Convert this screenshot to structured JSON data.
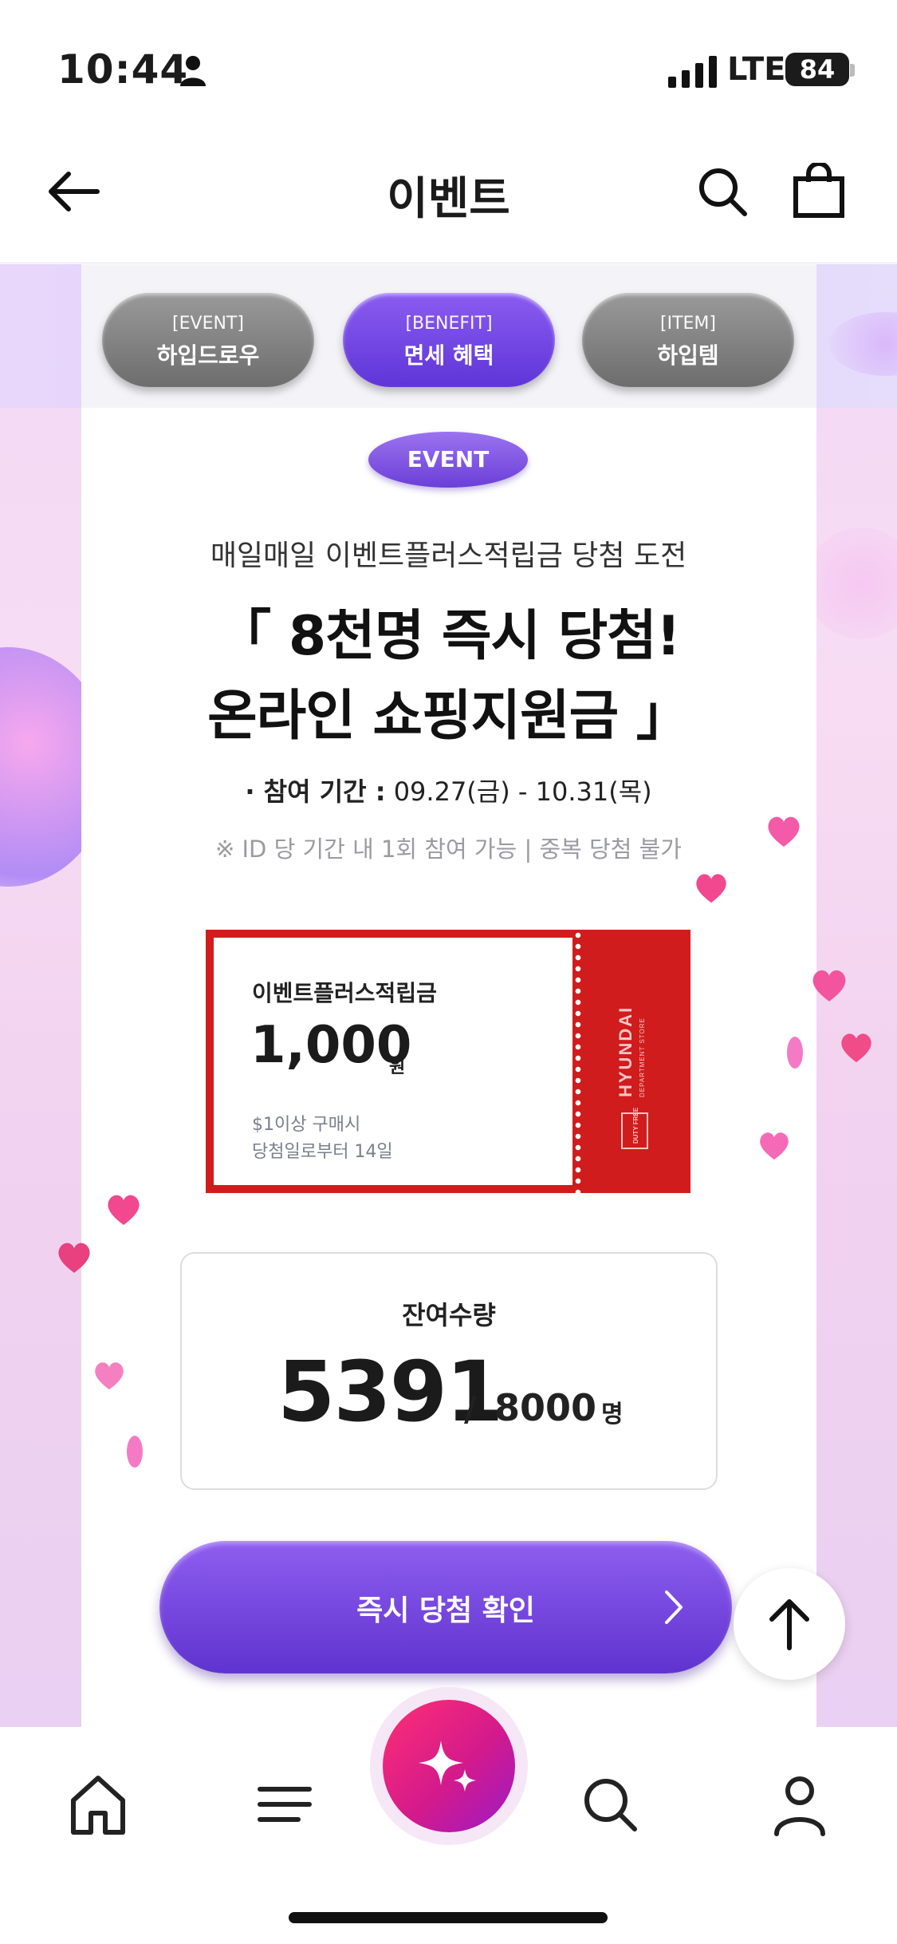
{
  "status_bar": {
    "time": "10:44",
    "network": "LTE",
    "battery": "84"
  },
  "header": {
    "title": "이벤트"
  },
  "tabs": [
    {
      "sub": "[EVENT]",
      "label": "하입드로우"
    },
    {
      "sub": "[BENEFIT]",
      "label": "면세 혜택"
    },
    {
      "sub": "[ITEM]",
      "label": "하입템"
    }
  ],
  "event": {
    "badge": "EVENT",
    "subtitle": "매일매일 이벤트플러스적립금 당첨 도전",
    "headline_line1": "「 8천명 즉시 당첨!",
    "headline_line2": "온라인 쇼핑지원금 」",
    "period_label": "· 참여 기간 :",
    "period_value": "09.27(금) - 10.31(목)",
    "notice": "※ ID 당 기간 내 1회 참여 가능 | 중복 당첨 불가"
  },
  "coupon": {
    "label": "이벤트플러스적립금",
    "amount": "1,000",
    "unit": "원",
    "condition_1": "$1이상 구매시",
    "condition_2": "당첨일로부터 14일",
    "brand": "HYUNDAI",
    "brand_sub": "DEPARTMENT STORE",
    "brand_tag": "DUTY FREE"
  },
  "remaining": {
    "label": "잔여수량",
    "count": "5391",
    "slash": "/",
    "total": "8000",
    "unit": "명"
  },
  "cta": {
    "label": "즉시 당첨 확인"
  },
  "colors": {
    "accent_purple": "#6a3fe0",
    "coupon_red": "#d01c1c",
    "nav_center_pink": "#ff2f74"
  },
  "bottom_nav": [
    "home-icon",
    "menu-icon",
    "sparkle-icon",
    "search-icon",
    "profile-icon"
  ]
}
